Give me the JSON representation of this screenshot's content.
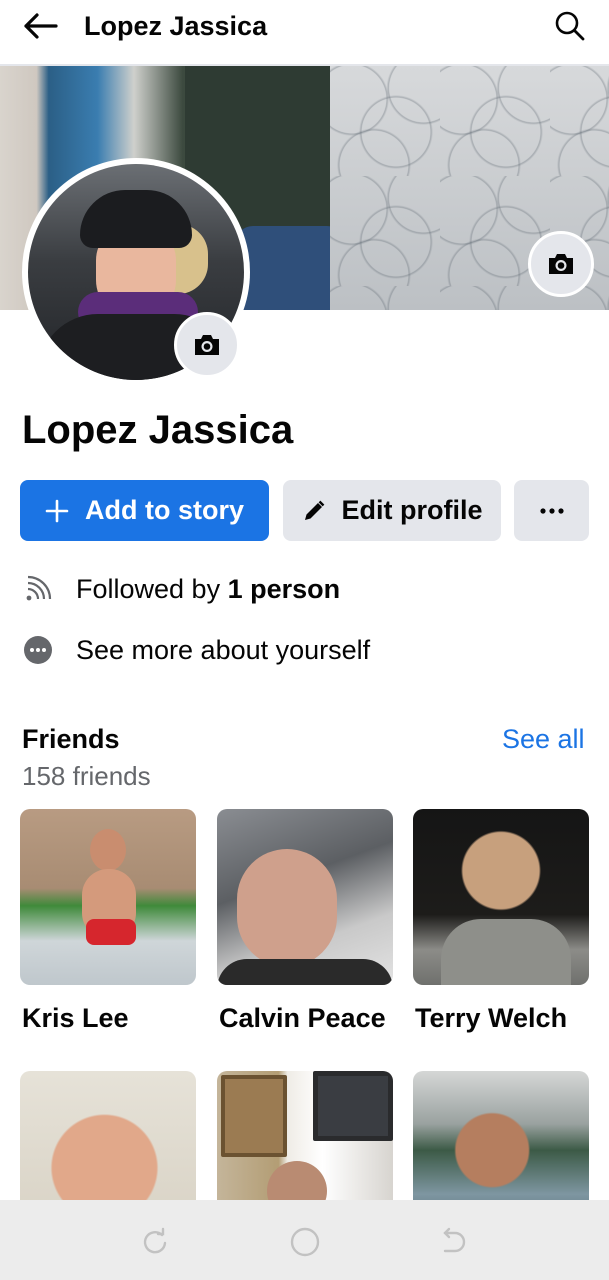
{
  "header": {
    "title": "Lopez Jassica",
    "back_icon": "arrow-left-icon",
    "search_icon": "search-icon"
  },
  "profile": {
    "name": "Lopez Jassica"
  },
  "actions": {
    "add_story_label": "Add to story",
    "edit_profile_label": "Edit profile",
    "more_label": "···"
  },
  "info": {
    "followed_prefix": "Followed by ",
    "followed_count": "1 person",
    "about_label": "See more about yourself"
  },
  "friends": {
    "title": "Friends",
    "count_label": "158 friends",
    "see_all_label": "See all",
    "items": [
      {
        "name": "Kris Lee"
      },
      {
        "name": "Calvin Peace"
      },
      {
        "name": "Terry Welch"
      }
    ]
  },
  "colors": {
    "accent": "#1b74e4",
    "button_gray": "#e4e6eb",
    "secondary_text": "#65676b"
  }
}
